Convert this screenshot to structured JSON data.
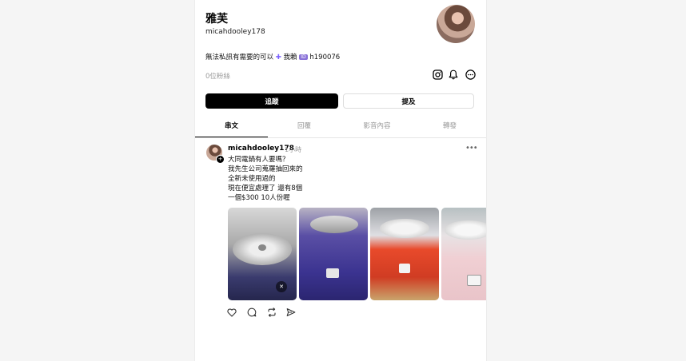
{
  "profile": {
    "name": "雅芙",
    "handle": "micahdooley178",
    "bio_prefix": "無法私訊有需要的可以",
    "bio_plus": "✚",
    "bio_middle": "我賴",
    "bio_badge": "ID",
    "bio_suffix": "h190076",
    "followers": "0位粉絲"
  },
  "buttons": {
    "follow_label": "追蹤",
    "mention_label": "提及"
  },
  "tabs": [
    {
      "label": "串文",
      "active": true
    },
    {
      "label": "回覆",
      "active": false
    },
    {
      "label": "影音內容",
      "active": false
    },
    {
      "label": "轉發",
      "active": false
    }
  ],
  "post": {
    "user": "micahdooley178",
    "time": "1小時",
    "more": "•••",
    "lines": [
      "大同電鍋有人要嗎？",
      "我先生公司蒐羅抽回來的",
      "全新未使用過的",
      "現在便宜處理了 還有8個",
      "一個$300 10人份喔"
    ]
  },
  "icons": {
    "instagram": "instagram-icon",
    "bell": "bell-icon",
    "more": "more-icon",
    "mute": "mute-icon",
    "like": "heart-icon",
    "comment": "comment-icon",
    "repost": "repost-icon",
    "share": "send-icon"
  }
}
